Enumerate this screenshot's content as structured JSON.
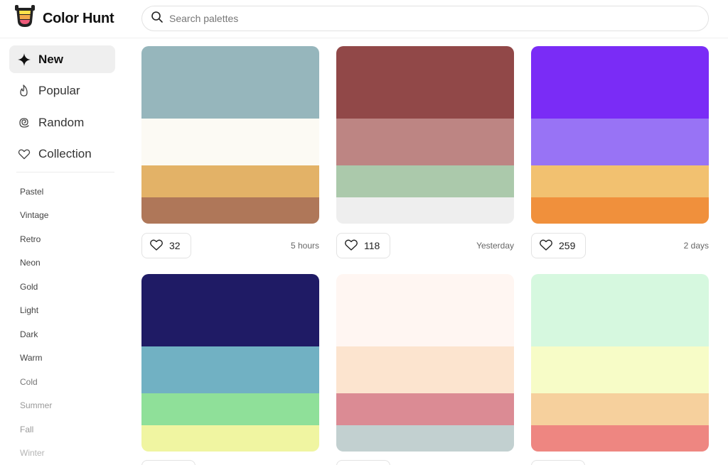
{
  "brand": {
    "name": "Color Hunt"
  },
  "search": {
    "placeholder": "Search palettes"
  },
  "nav": [
    {
      "label": "New",
      "icon": "sparkle-icon",
      "active": true
    },
    {
      "label": "Popular",
      "icon": "flame-icon",
      "active": false
    },
    {
      "label": "Random",
      "icon": "spiral-icon",
      "active": false
    },
    {
      "label": "Collection",
      "icon": "heart-outline-icon",
      "active": false
    }
  ],
  "tags": [
    "Pastel",
    "Vintage",
    "Retro",
    "Neon",
    "Gold",
    "Light",
    "Dark",
    "Warm",
    "Cold",
    "Summer",
    "Fall",
    "Winter"
  ],
  "palettes": [
    {
      "colors": [
        "#96b6bc",
        "#fcfaf4",
        "#e3b267",
        "#af7759"
      ],
      "likes": "32",
      "time": "5 hours"
    },
    {
      "colors": [
        "#914848",
        "#bd8583",
        "#abc9ab",
        "#eeeeee"
      ],
      "likes": "118",
      "time": "Yesterday"
    },
    {
      "colors": [
        "#7a2cf6",
        "#9873f5",
        "#f2c170",
        "#f0903c"
      ],
      "likes": "259",
      "time": "2 days"
    },
    {
      "colors": [
        "#1f1b65",
        "#71b1c3",
        "#8fe099",
        "#f0f5a1"
      ],
      "likes": "",
      "time": ""
    },
    {
      "colors": [
        "#fff6f2",
        "#fce4cf",
        "#db8b94",
        "#c2d0d0"
      ],
      "likes": "",
      "time": ""
    },
    {
      "colors": [
        "#d6f8df",
        "#f7fcc7",
        "#f6d09d",
        "#ee8681"
      ],
      "likes": "",
      "time": ""
    }
  ]
}
